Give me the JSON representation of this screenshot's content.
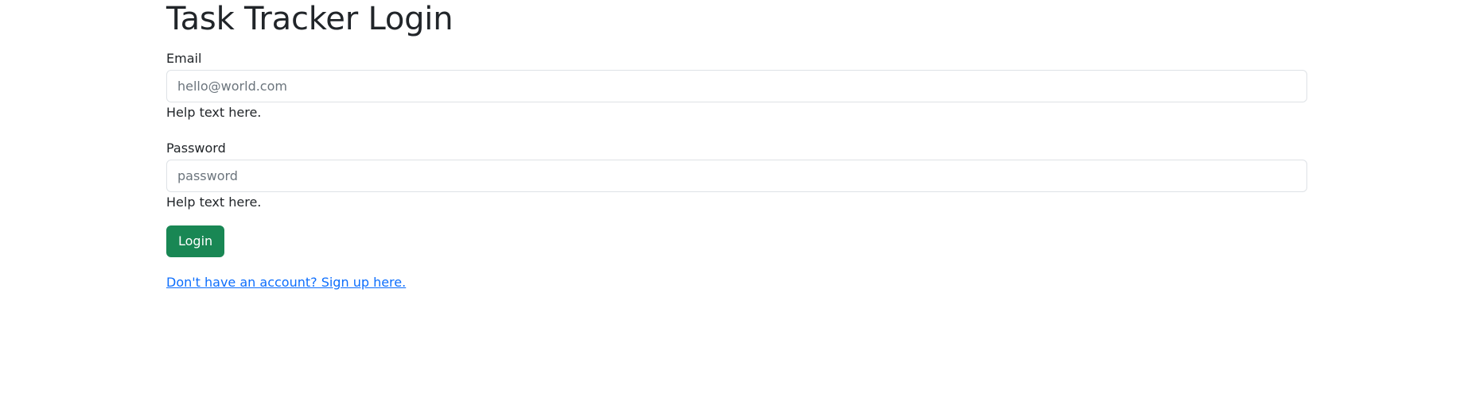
{
  "page": {
    "title": "Task Tracker Login"
  },
  "form": {
    "email": {
      "label": "Email",
      "placeholder": "hello@world.com",
      "value": "",
      "help": "Help text here."
    },
    "password": {
      "label": "Password",
      "placeholder": "password",
      "value": "",
      "help": "Help text here."
    },
    "submit_label": "Login",
    "signup_link": "Don't have an account? Sign up here."
  },
  "colors": {
    "primary_button": "#198754",
    "link": "#0d6efd",
    "text": "#212529",
    "placeholder": "#6c757d",
    "input_border": "#dee2e6"
  }
}
